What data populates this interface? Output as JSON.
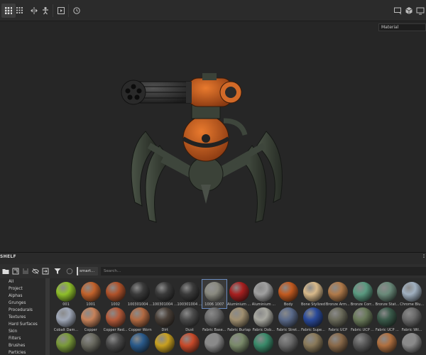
{
  "viewport": {
    "channel_select": "Material"
  },
  "shelf": {
    "title": "SHELF",
    "filter_tag": "smart...",
    "search_placeholder": "Search...",
    "categories": [
      "All",
      "Project",
      "Alphas",
      "Grunges",
      "Procedurals",
      "Textures",
      "Hard Surfaces",
      "Skin",
      "Filters",
      "Brushes",
      "Particles"
    ],
    "materials_row1": [
      {
        "label": "001",
        "color": "#8fbf2a"
      },
      {
        "label": "1001",
        "color": "#c2622b"
      },
      {
        "label": "1002",
        "color": "#b0522a"
      },
      {
        "label": "100301004 ...",
        "color": "#3a3a3a"
      },
      {
        "label": "100301004 ...",
        "color": "#3a3a3a"
      },
      {
        "label": "100301004 ...",
        "color": "#3a3a3a"
      },
      {
        "label": "1006 1007",
        "color": "#8a8a80"
      },
      {
        "label": "Aluminium ...",
        "color": "#a82020"
      },
      {
        "label": "Aluminium ...",
        "color": "#a0a0a0"
      },
      {
        "label": "Body",
        "color": "#c25a20"
      },
      {
        "label": "Bone Stylized",
        "color": "#d8b98a"
      },
      {
        "label": "Bronze Arm...",
        "color": "#b07a4a"
      },
      {
        "label": "Bronze Corr...",
        "color": "#5a9a80"
      },
      {
        "label": "Bronze Stat...",
        "color": "#6a8a7a"
      },
      {
        "label": "Chrome Blu...",
        "color": "#a0b0c0"
      }
    ],
    "materials_row2": [
      {
        "label": "Cobalt Dam...",
        "color": "#a0a8b8"
      },
      {
        "label": "Copper",
        "color": "#c7825a"
      },
      {
        "label": "Copper Red...",
        "color": "#b45a3a"
      },
      {
        "label": "Copper Worn",
        "color": "#b26a42"
      },
      {
        "label": "Dirt",
        "color": "#4a4038"
      },
      {
        "label": "Dust",
        "color": "#4a4a4a"
      },
      {
        "label": "Fabric Base...",
        "color": "#6a6a6a"
      },
      {
        "label": "Fabric Burlap",
        "color": "#a08f70"
      },
      {
        "label": "Fabric Dob...",
        "color": "#a8a8a0"
      },
      {
        "label": "Fabric Stret...",
        "color": "#5a6a8a"
      },
      {
        "label": "Fabric Supe...",
        "color": "#2a4a9a"
      },
      {
        "label": "Fabric UCP",
        "color": "#6a6a5a"
      },
      {
        "label": "Fabric UCP ...",
        "color": "#6a7a5a"
      },
      {
        "label": "Fabric UCP ...",
        "color": "#3a5a4a"
      },
      {
        "label": "Fabric Wil...",
        "color": "#6a6a6a"
      }
    ],
    "materials_row3": [
      {
        "color": "#7a9a3a"
      },
      {
        "color": "#6a6a60"
      },
      {
        "color": "#4a4a4a"
      },
      {
        "color": "#2a5a8a"
      },
      {
        "color": "#c8a020"
      },
      {
        "color": "#c84a2a"
      },
      {
        "color": "#8a8a8a"
      },
      {
        "color": "#7a8a6a"
      },
      {
        "color": "#3a8a6a"
      },
      {
        "color": "#6a6a6a"
      },
      {
        "color": "#8a7a5a"
      },
      {
        "color": "#8a6a4a"
      },
      {
        "color": "#5a5a5a"
      },
      {
        "color": "#b07040"
      },
      {
        "color": "#8a8a8a"
      }
    ]
  }
}
